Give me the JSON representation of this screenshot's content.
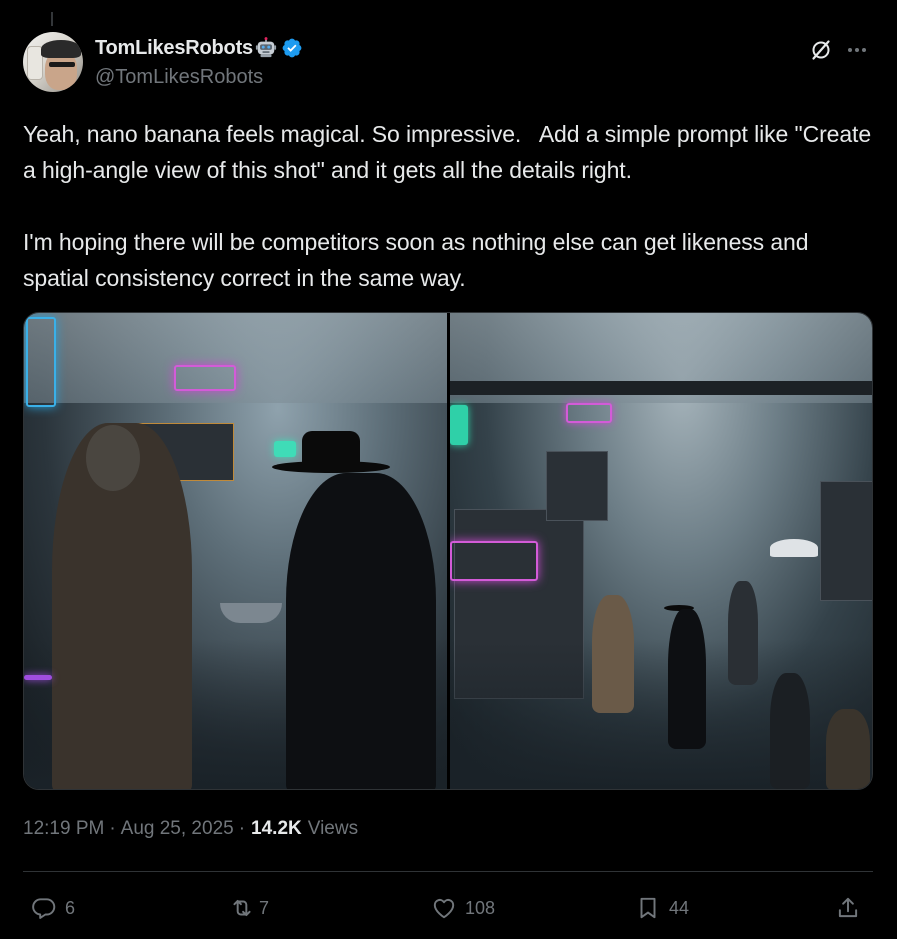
{
  "author": {
    "display_name": "TomLikesRobots",
    "handle": "@TomLikesRobots"
  },
  "tweet": {
    "text": "Yeah, nano banana feels magical. So impressive.   Add a simple prompt like \"Create a high-angle view of this shot\" and it gets all the details right.\n\nI'm hoping there will be competitors soon as nothing else can get likeness and spatial consistency correct in the same way."
  },
  "meta": {
    "time": "12:19 PM",
    "separator1": "·",
    "date": "Aug 25, 2025",
    "separator2": "·",
    "views_count": "14.2K",
    "views_label": "Views"
  },
  "actions": {
    "replies": "6",
    "reposts": "7",
    "likes": "108",
    "bookmarks": "44"
  },
  "icons": {
    "verified": "verified-badge-icon",
    "emoji": "robot-emoji-icon",
    "grok": "grok-icon",
    "more": "more-icon",
    "reply": "reply-icon",
    "repost": "repost-icon",
    "like": "heart-icon",
    "bookmark": "bookmark-icon",
    "share": "share-icon"
  },
  "colors": {
    "background": "#000000",
    "text": "#e7e9ea",
    "secondary": "#71767b",
    "verified": "#1d9bf0",
    "divider": "#2f3336"
  }
}
